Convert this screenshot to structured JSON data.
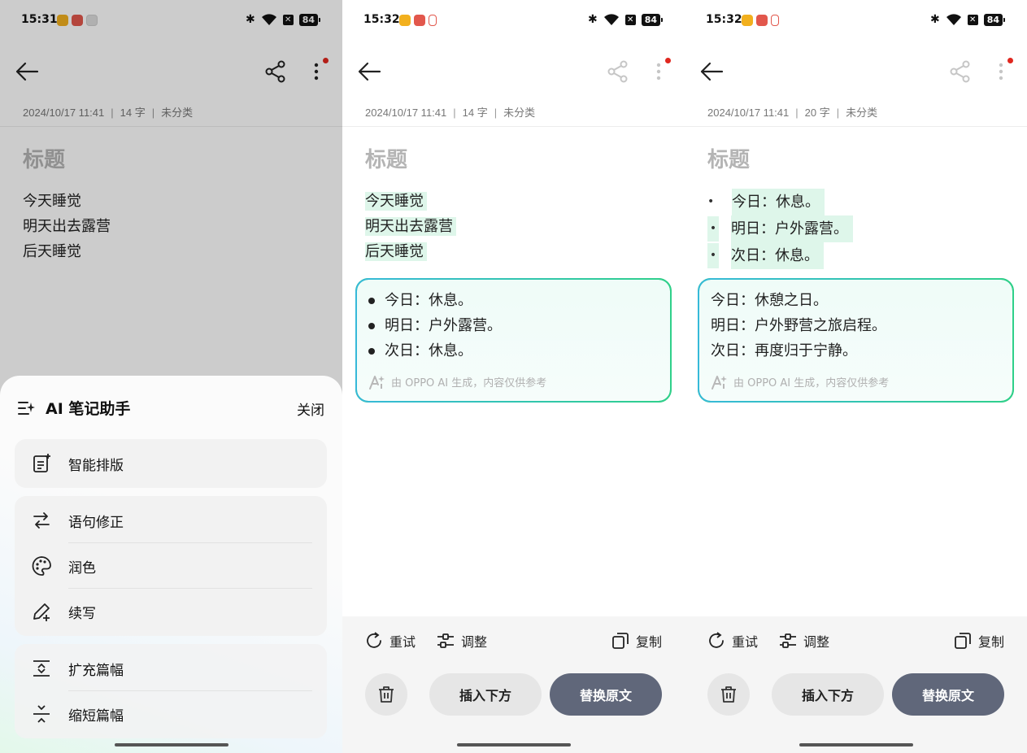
{
  "status": {
    "panel1_time": "15:31",
    "panel2_time": "15:32",
    "panel3_time": "15:32",
    "battery": "84",
    "battery_x": "✕"
  },
  "note": {
    "date": "2024/10/17 11:41",
    "category": "未分类",
    "count_p1": "14 字",
    "count_p2": "14 字",
    "count_p3": "20 字",
    "title_placeholder": "标题",
    "original_lines": [
      "今天睡觉",
      "明天出去露营",
      "后天睡觉"
    ],
    "bullet_lines": [
      "今日：休息。",
      "明日：户外露营。",
      "次日：休息。"
    ]
  },
  "ai_sheet": {
    "title": "AI 笔记助手",
    "close": "关闭",
    "items": [
      "智能排版",
      "语句修正",
      "润色",
      "续写",
      "扩充篇幅",
      "缩短篇幅"
    ]
  },
  "panel2_result": [
    "今日：休息。",
    "明日：户外露营。",
    "次日：休息。"
  ],
  "panel3_result": [
    "今日：休憩之日。",
    "明日：户外野营之旅启程。",
    "次日：再度归于宁静。"
  ],
  "ai_note": "由 OPPO AI 生成，内容仅供参考",
  "actions": {
    "retry": "重试",
    "adjust": "调整",
    "copy": "复制",
    "insert": "插入下方",
    "replace": "替换原文"
  },
  "colors": {
    "highlight": "#def6ea",
    "ai_border_start": "#36b9d9",
    "ai_border_end": "#2fd08a",
    "replace_button": "#60677a",
    "red_dot": "#e0271f"
  }
}
